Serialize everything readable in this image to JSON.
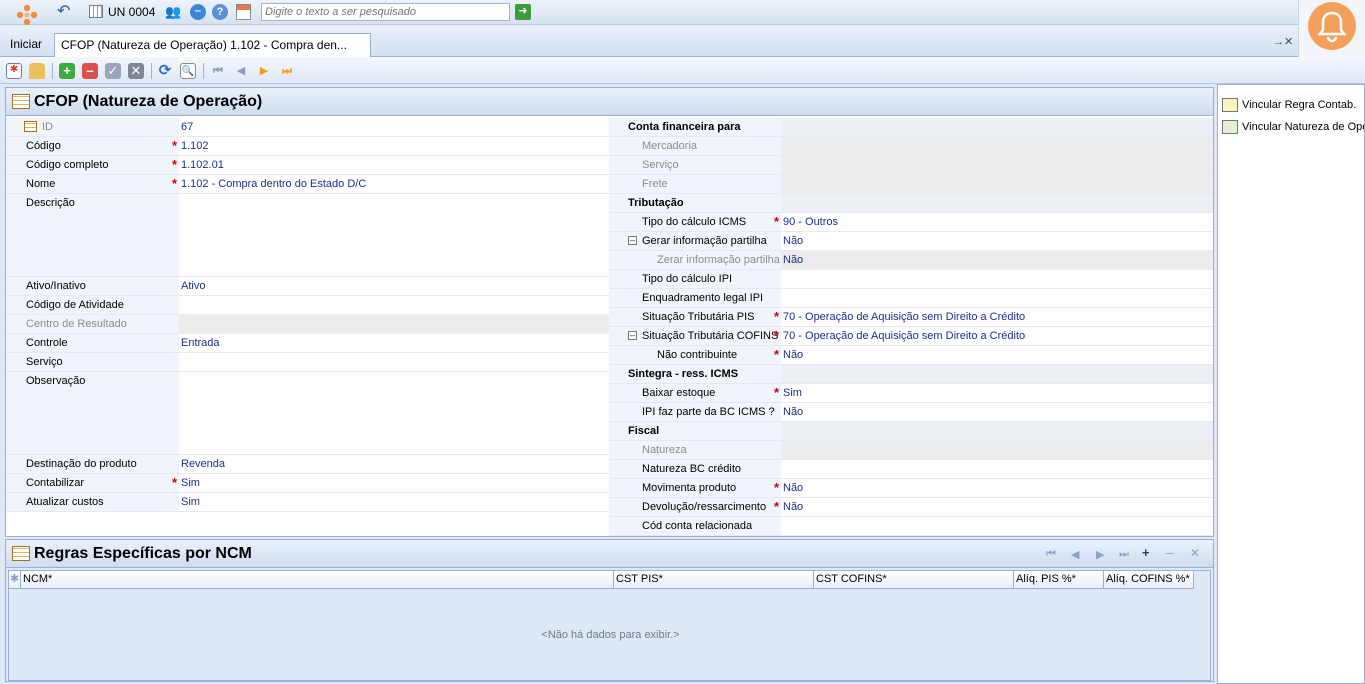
{
  "topbar": {
    "unit_label": "UN 0004",
    "search_placeholder": "Digite o texto a ser pesquisado"
  },
  "tabs": {
    "home": "Iniciar",
    "active": "CFOP (Natureza de Operação) 1.102 - Compra den...",
    "pin": "→✕"
  },
  "form": {
    "title": "CFOP (Natureza de Operação)",
    "left": [
      {
        "label": "ID",
        "value": "67"
      },
      {
        "label": "Código",
        "value": "1.102"
      },
      {
        "label": "Código completo",
        "value": "1.102.01"
      },
      {
        "label": "Nome",
        "value": "1.102 - Compra dentro do Estado D/C"
      },
      {
        "label": "Descrição",
        "value": ""
      },
      {
        "label": "Ativo/Inativo",
        "value": "Ativo"
      },
      {
        "label": "Código de Atividade",
        "value": ""
      },
      {
        "label": "Centro de Resultado",
        "value": ""
      },
      {
        "label": "Controle",
        "value": "Entrada"
      },
      {
        "label": "Serviço",
        "value": ""
      },
      {
        "label": "Observação",
        "value": ""
      },
      {
        "label": "Destinação do produto",
        "value": "Revenda"
      },
      {
        "label": "Contabilizar",
        "value": "Sim"
      },
      {
        "label": "Atualizar custos",
        "value": "Sim"
      }
    ],
    "right": [
      {
        "label": "Conta financeira para",
        "value": ""
      },
      {
        "label": "Mercadoria",
        "value": ""
      },
      {
        "label": "Serviço",
        "value": ""
      },
      {
        "label": "Frete",
        "value": ""
      },
      {
        "label": "Tributação",
        "value": ""
      },
      {
        "label": "Tipo do cálculo ICMS",
        "value": "90 - Outros"
      },
      {
        "label": "Gerar informação partilha",
        "value": "Não"
      },
      {
        "label": "Zerar informação partilha",
        "value": "Não"
      },
      {
        "label": "Tipo do cálculo IPI",
        "value": ""
      },
      {
        "label": "Enquadramento legal IPI",
        "value": ""
      },
      {
        "label": "Situação Tributária PIS",
        "value": "70 - Operação de Aquisição sem Direito a Crédito"
      },
      {
        "label": "Situação Tributária COFINS",
        "value": "70 - Operação de Aquisição sem Direito a Crédito"
      },
      {
        "label": "Não contribuinte",
        "value": "Não"
      },
      {
        "label": "Sintegra - ress. ICMS",
        "value": ""
      },
      {
        "label": "Baixar estoque",
        "value": "Sim"
      },
      {
        "label": "IPI faz parte da BC ICMS ?",
        "value": "Não"
      },
      {
        "label": "Fiscal",
        "value": ""
      },
      {
        "label": "Natureza",
        "value": ""
      },
      {
        "label": "Natureza BC crédito",
        "value": ""
      },
      {
        "label": "Movimenta produto",
        "value": "Não"
      },
      {
        "label": "Devolução/ressarcimento",
        "value": "Não"
      },
      {
        "label": "Cód conta relacionada",
        "value": ""
      }
    ]
  },
  "side_actions": [
    {
      "label": "Vincular Regra Contab."
    },
    {
      "label": "Vincular Natureza de Operação"
    }
  ],
  "ncm": {
    "title": "Regras Específicas por NCM",
    "columns": [
      "NCM*",
      "CST PIS*",
      "CST COFINS*",
      "Alíq. PIS %*",
      "Alíq. COFINS %*"
    ],
    "empty": "<Não há dados para exibir.>"
  }
}
